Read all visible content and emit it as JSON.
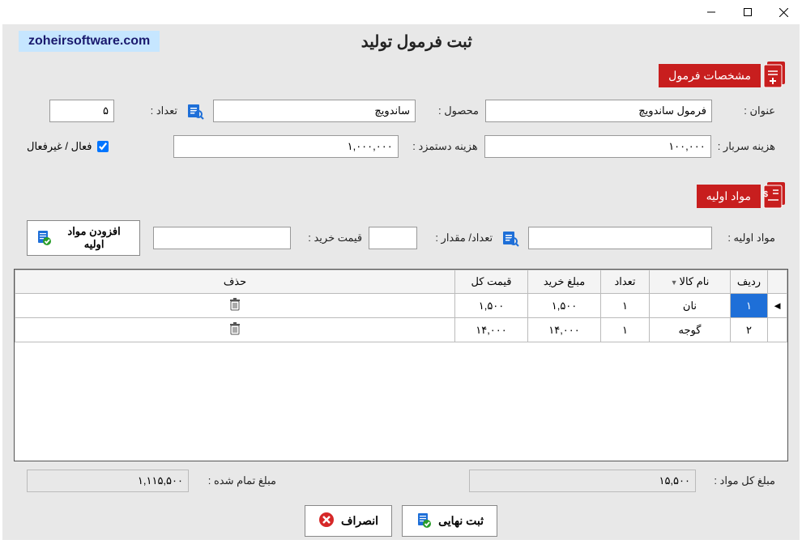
{
  "brand": "zoheirsoftware.com",
  "page_title": "ثبت فرمول تولید",
  "sections": {
    "spec": "مشخصات فرمول",
    "materials": "مواد اولیه"
  },
  "labels": {
    "title": "عنوان :",
    "product": "محصول :",
    "count": "تعداد :",
    "overhead": "هزینه سربار :",
    "wage": "هزینه دستمزد :",
    "active": "فعال / غیرفعال",
    "material": "مواد اولیه :",
    "qty_amount": "تعداد/ مقدار :",
    "buy_price": "قیمت خرید :",
    "add_material": "افزودن مواد اولیه",
    "total_materials": "مبلغ کل مواد :",
    "final_cost": "مبلغ تمام شده :",
    "submit": "ثبت نهایی",
    "cancel": "انصراف"
  },
  "values": {
    "title": "فرمول ساندویچ",
    "product": "ساندویچ",
    "count": "۵",
    "overhead": "۱۰۰,۰۰۰",
    "wage": "۱,۰۰۰,۰۰۰",
    "active_checked": true,
    "material": "",
    "qty_amount": "",
    "buy_price": "",
    "total_materials": "۱۵,۵۰۰",
    "final_cost": "۱,۱۱۵,۵۰۰"
  },
  "table": {
    "headers": {
      "idx": "ردیف",
      "name": "نام کالا",
      "qty": "تعداد",
      "buy": "مبلغ خرید",
      "total": "قیمت کل",
      "del": "حذف"
    },
    "rows": [
      {
        "idx": "۱",
        "name": "نان",
        "qty": "۱",
        "buy": "۱,۵۰۰",
        "total": "۱,۵۰۰"
      },
      {
        "idx": "۲",
        "name": "گوجه",
        "qty": "۱",
        "buy": "۱۴,۰۰۰",
        "total": "۱۴,۰۰۰"
      }
    ]
  }
}
